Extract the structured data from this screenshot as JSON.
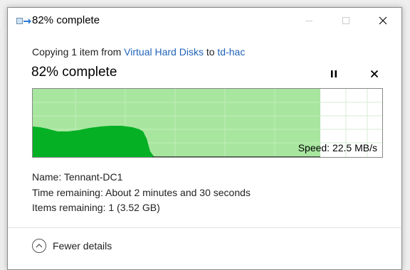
{
  "window": {
    "title": "82% complete"
  },
  "copy": {
    "prefix": "Copying 1 item from ",
    "source": "Virtual Hard Disks",
    "middle": " to ",
    "destination": "td-hac",
    "status_title": "82% complete",
    "progress_fraction": 0.82
  },
  "graph": {
    "speed_label": "Speed: 22.5 MB/s"
  },
  "details": {
    "name_label": "Name:",
    "name_value": "Tennant-DC1",
    "time_label": "Time remaining:",
    "time_value": "About 2 minutes and 30 seconds",
    "items_label": "Items remaining:",
    "items_value": "1 (3.52 GB)"
  },
  "footer": {
    "toggle_label": "Fewer details"
  },
  "colors": {
    "progress_fill": "#a8e6a0",
    "speed_fill": "#06b025",
    "link": "#1f63b8"
  }
}
